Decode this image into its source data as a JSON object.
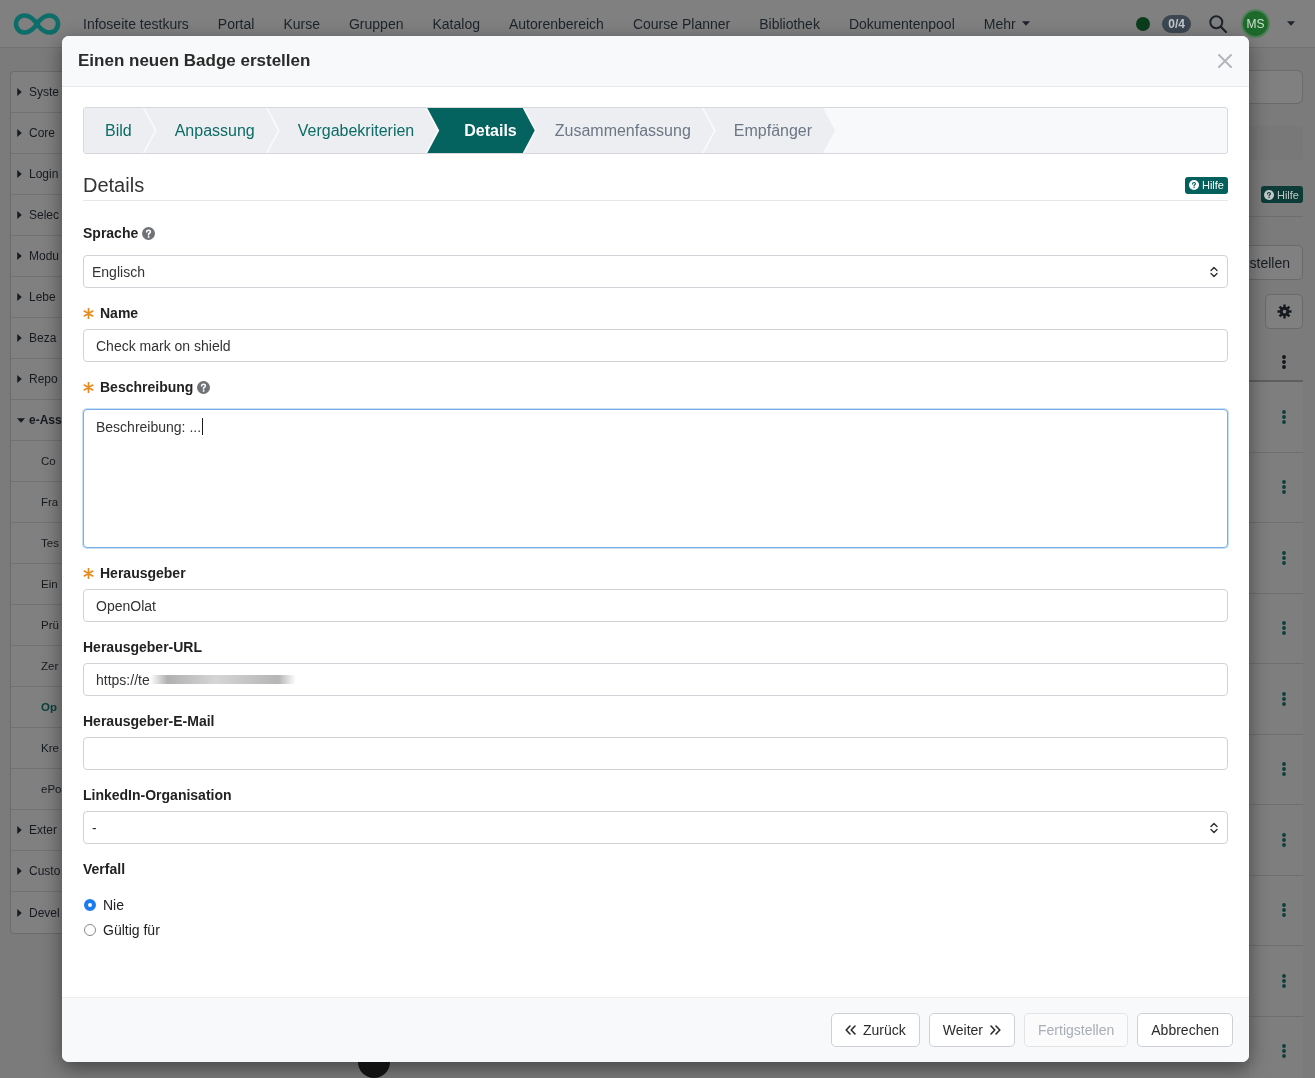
{
  "top_nav": {
    "items": [
      "Infoseite testkurs",
      "Portal",
      "Kurse",
      "Gruppen",
      "Katalog",
      "Autorenbereich",
      "Course Planner",
      "Bibliothek",
      "Dokumentenpool"
    ],
    "more": "Mehr",
    "counter": "0/4",
    "avatar": "MS"
  },
  "sidebar": {
    "items": [
      {
        "label": "Syste",
        "expanded": false,
        "selected": false
      },
      {
        "label": "Core",
        "expanded": false,
        "selected": false
      },
      {
        "label": "Login",
        "expanded": false,
        "selected": false
      },
      {
        "label": "Selec",
        "expanded": false,
        "selected": false
      },
      {
        "label": "Modu",
        "expanded": false,
        "selected": false
      },
      {
        "label": "Lebe",
        "expanded": false,
        "selected": false
      },
      {
        "label": "Beza",
        "expanded": false,
        "selected": false
      },
      {
        "label": "Repo",
        "expanded": false,
        "selected": false
      },
      {
        "label": "e-Ass",
        "expanded": true,
        "selected": false,
        "children": [
          {
            "label": "Co",
            "selected": false
          },
          {
            "label": "Fra",
            "selected": false
          },
          {
            "label": "Tes",
            "selected": false
          },
          {
            "label": "Ein",
            "selected": false
          },
          {
            "label": "Prü",
            "selected": false
          },
          {
            "label": "Zer",
            "selected": false
          },
          {
            "label": "Op",
            "selected": true
          },
          {
            "label": "Kre",
            "selected": false
          },
          {
            "label": "ePo",
            "selected": false
          }
        ]
      },
      {
        "label": "Exter",
        "expanded": false,
        "selected": false
      },
      {
        "label": "Custo",
        "expanded": false,
        "selected": false
      },
      {
        "label": "Devel",
        "expanded": false,
        "selected": false
      }
    ]
  },
  "background_panel": {
    "help": "Hilfe",
    "button": "stellen"
  },
  "dialog": {
    "title": "Einen neuen Badge erstellen",
    "steps": [
      {
        "label": "Bild",
        "completed": true,
        "selected": false
      },
      {
        "label": "Anpassung",
        "completed": true,
        "selected": false
      },
      {
        "label": "Vergabekriterien",
        "completed": true,
        "selected": false
      },
      {
        "label": "Details",
        "completed": false,
        "selected": true
      },
      {
        "label": "Zusammenfassung",
        "completed": false,
        "selected": false
      },
      {
        "label": "Empfänger",
        "completed": false,
        "selected": false
      }
    ],
    "section": {
      "title": "Details",
      "help": "Hilfe"
    },
    "fields": [
      {
        "kind": "select",
        "label": "Sprache",
        "help": true,
        "focused": false,
        "value": "Englisch"
      },
      {
        "kind": "text",
        "label": "Name",
        "required": true,
        "focused": false,
        "value": "Check mark on shield"
      },
      {
        "kind": "textarea",
        "label": "Beschreibung",
        "required": true,
        "help": true,
        "focused": true,
        "value": "Beschreibung: ..."
      },
      {
        "kind": "text",
        "label": "Herausgeber",
        "required": true,
        "focused": false,
        "value": "OpenOlat"
      },
      {
        "kind": "text",
        "label": "Herausgeber-URL",
        "focused": false,
        "value": "https://te",
        "redacted": true
      },
      {
        "kind": "text",
        "label": "Herausgeber-E-Mail",
        "focused": false
      },
      {
        "kind": "select",
        "label": "LinkedIn-Organisation",
        "focused": false,
        "value": "-"
      },
      {
        "kind": "radio",
        "label": "Verfall",
        "options": [
          {
            "label": "Nie",
            "selected": true
          },
          {
            "label": "Gültig für",
            "selected": false
          }
        ]
      }
    ],
    "buttons": [
      {
        "label": "Zurück",
        "kind": "back",
        "disabled": false
      },
      {
        "label": "Weiter",
        "kind": "next",
        "disabled": false
      },
      {
        "label": "Fertigstellen",
        "kind": "finish",
        "disabled": true
      },
      {
        "label": "Abbrechen",
        "kind": "cancel",
        "disabled": false
      }
    ]
  }
}
